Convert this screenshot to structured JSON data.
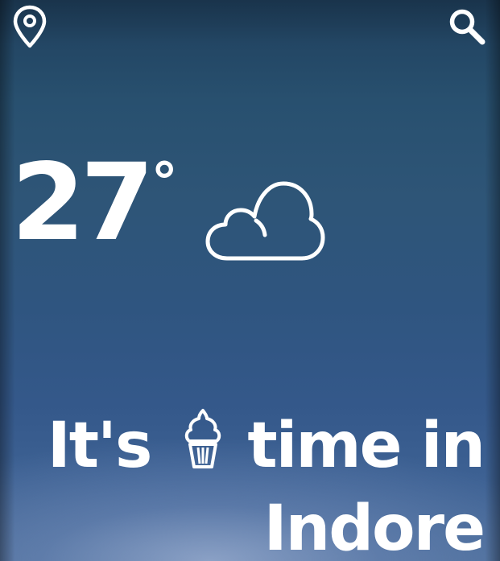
{
  "header": {
    "location_icon": "map-pin-icon",
    "search_icon": "search-icon"
  },
  "weather": {
    "temperature": "27",
    "degree_symbol": "°",
    "condition_icon": "cloud-icon"
  },
  "message": {
    "prefix": "It's",
    "food_icon": "ice-cream-icon",
    "middle": "time in",
    "city": "Indore"
  }
}
